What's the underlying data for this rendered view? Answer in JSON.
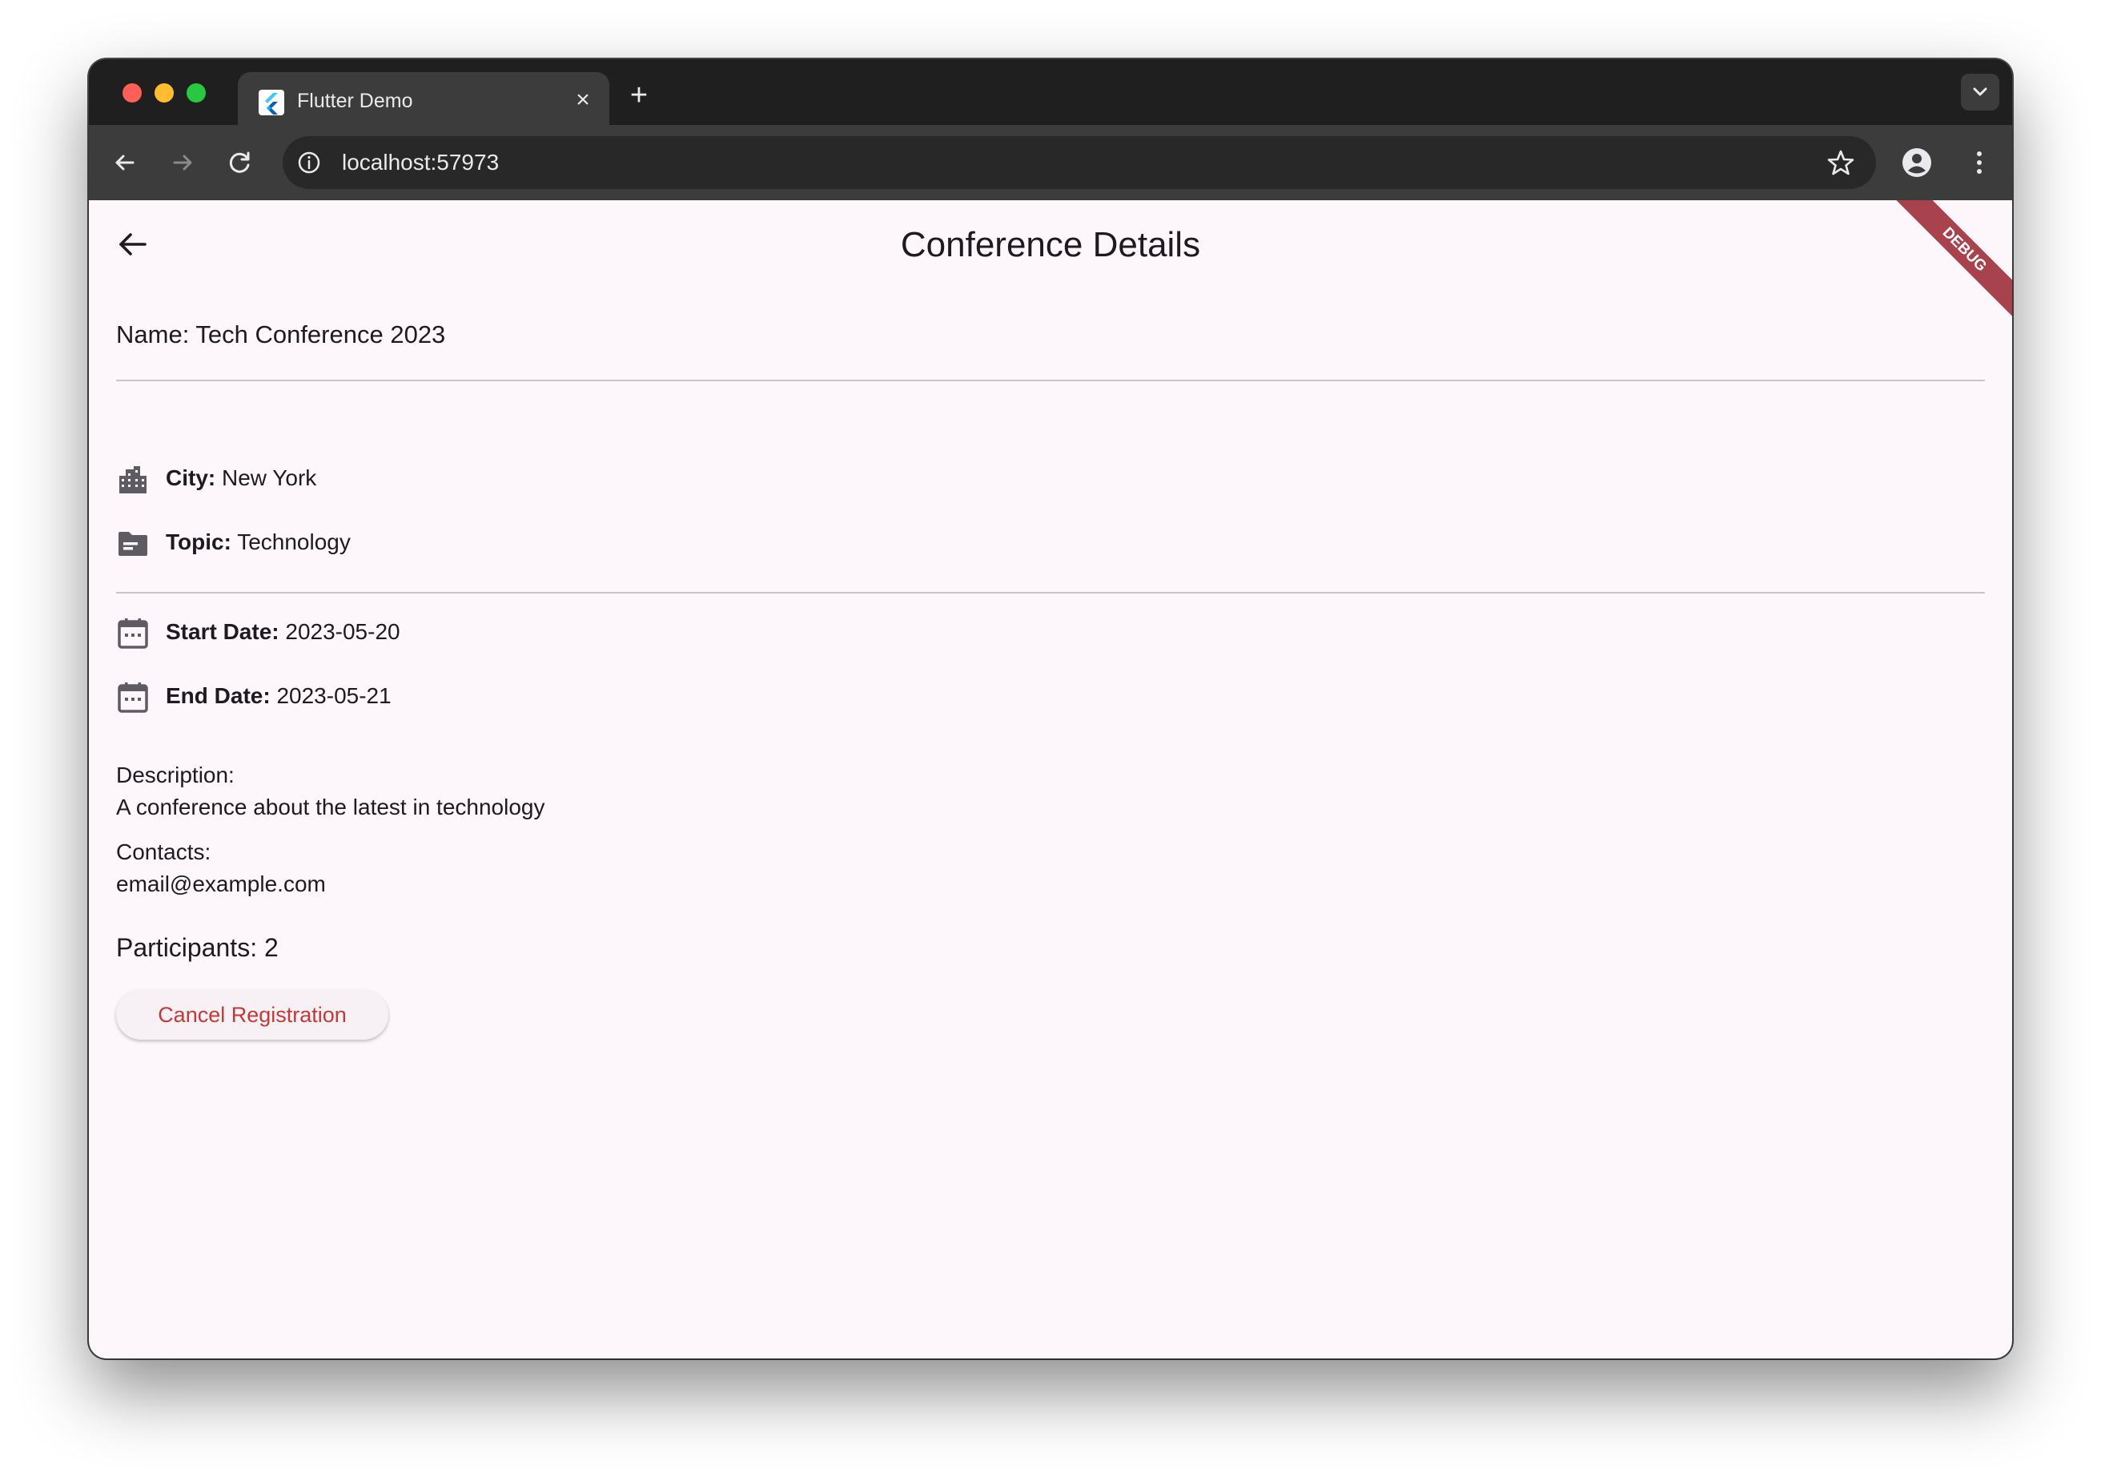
{
  "browser": {
    "tab_title": "Flutter Demo",
    "tab_close": "×",
    "new_tab": "+",
    "url": "localhost:57973"
  },
  "appbar": {
    "title": "Conference Details",
    "debug_banner": "DEBUG"
  },
  "conference": {
    "name_line": "Name: Tech Conference 2023",
    "city_label": "City:",
    "city_value": " New York",
    "topic_label": "Topic:",
    "topic_value": " Technology",
    "start_label": "Start Date:",
    "start_value": " 2023-05-20",
    "end_label": "End Date:",
    "end_value": " 2023-05-21",
    "description_label": "Description:",
    "description_value": "A conference about the latest in technology",
    "contacts_label": "Contacts:",
    "contacts_value": "email@example.com",
    "participants": "Participants: 2"
  },
  "actions": {
    "cancel_label": "Cancel Registration"
  },
  "icons": {
    "city": "location-city-icon",
    "topic": "topic-icon",
    "start": "calendar-icon",
    "end": "calendar-icon"
  },
  "colors": {
    "page_background": "#fdf7fc",
    "cancel_text": "#c23a37",
    "debug_banner": "#a8424c"
  }
}
